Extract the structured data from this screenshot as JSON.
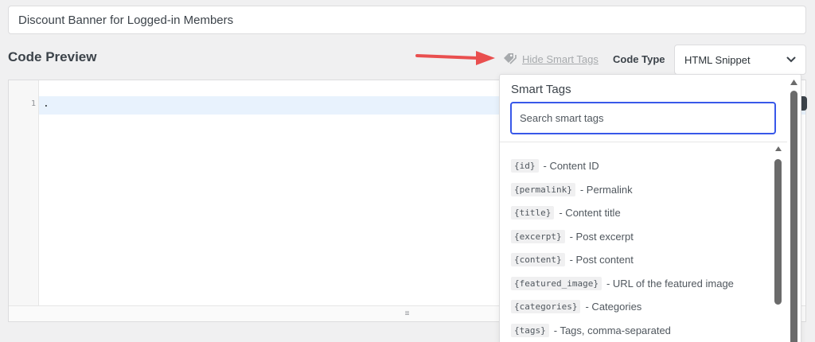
{
  "snippet_title": {
    "value": "Discount Banner for Logged-in Members"
  },
  "code_preview": {
    "title": "Code Preview",
    "line_number": "1",
    "line_content": "."
  },
  "smart_tags_toggle": {
    "label": "Hide Smart Tags",
    "icon": "tag-icon"
  },
  "code_type": {
    "label": "Code Type",
    "selected": "HTML Snippet"
  },
  "smart_tags_panel": {
    "title": "Smart Tags",
    "search_placeholder": "Search smart tags",
    "items": [
      {
        "tag": "{id}",
        "desc": "- Content ID"
      },
      {
        "tag": "{permalink}",
        "desc": "- Permalink"
      },
      {
        "tag": "{title}",
        "desc": "- Content title"
      },
      {
        "tag": "{excerpt}",
        "desc": "- Post excerpt"
      },
      {
        "tag": "{content}",
        "desc": "- Post content"
      },
      {
        "tag": "{featured_image}",
        "desc": "- URL of the featured image"
      },
      {
        "tag": "{categories}",
        "desc": "- Categories"
      },
      {
        "tag": "{tags}",
        "desc": "- Tags, comma-separated"
      }
    ]
  },
  "resize_handle": {
    "glyph": "≡"
  },
  "colors": {
    "accent": "#3858e9",
    "annotation_arrow": "#e94f4f",
    "active_line": "#e8f2fd"
  }
}
